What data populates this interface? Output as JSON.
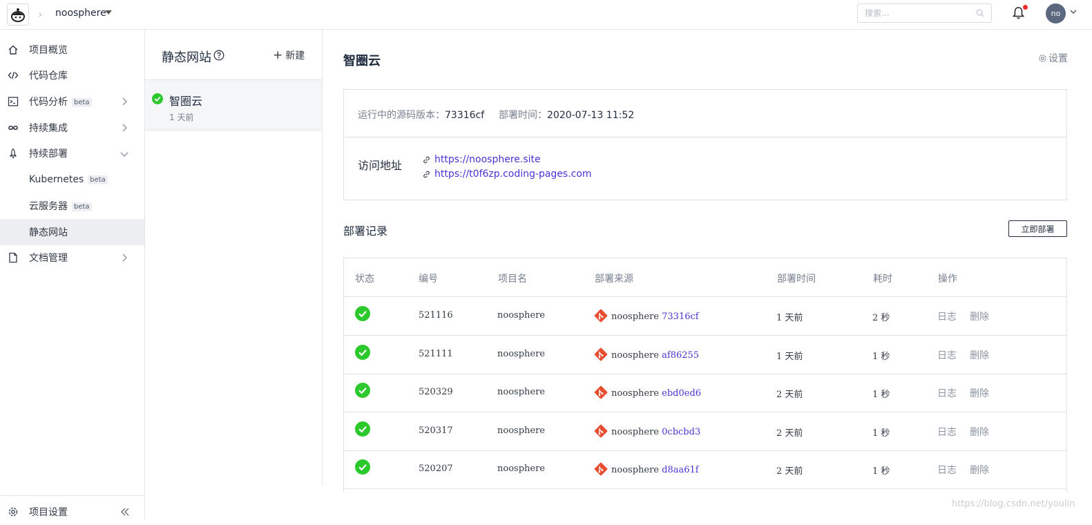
{
  "header": {
    "project_name": "noosphere",
    "search_placeholder": "搜索...",
    "avatar_initials": "no",
    "colors": {
      "notification_dot": "#f02d2d",
      "avatar_bg": "#5c6780"
    }
  },
  "sidebar": {
    "items": [
      {
        "label": "项目概览",
        "icon": "home-icon"
      },
      {
        "label": "代码仓库",
        "icon": "code-icon"
      },
      {
        "label": "代码分析",
        "icon": "terminal-icon",
        "badge": "beta"
      },
      {
        "label": "持续集成",
        "icon": "infinity-icon"
      },
      {
        "label": "持续部署",
        "icon": "rocket-icon"
      },
      {
        "label": "Kubernetes",
        "badge": "beta"
      },
      {
        "label": "云服务器",
        "badge": "beta"
      },
      {
        "label": "静态网站"
      },
      {
        "label": "文档管理",
        "icon": "document-icon"
      }
    ],
    "bottom": {
      "label": "项目设置"
    }
  },
  "sites_panel": {
    "title": "静态网站",
    "new_label": "新建",
    "sites": [
      {
        "name": "智圈云",
        "time": "1 天前"
      }
    ]
  },
  "main": {
    "title": "智圈云",
    "settings_label": "设置",
    "source_label": "运行中的源码版本：",
    "source_value": "73316cf",
    "deploy_time_label": "部署时间：",
    "deploy_time_value": "2020-07-13 11:52",
    "visit_label": "访问地址",
    "links": [
      "https://noosphere.site",
      "https://t0f6zp.coding-pages.com"
    ],
    "records_title": "部署记录",
    "deploy_now": "立即部署",
    "table": {
      "headers": [
        "状态",
        "编号",
        "项目名",
        "部署来源",
        "部署时间",
        "耗时",
        "操作"
      ],
      "rows": [
        {
          "id": "521116",
          "project": "noosphere",
          "source": "noosphere",
          "commit": "73316cf",
          "time": "1 天前",
          "duration": "2 秒",
          "log": "日志",
          "delete": "删除"
        },
        {
          "id": "521111",
          "project": "noosphere",
          "source": "noosphere",
          "commit": "af86255",
          "time": "1 天前",
          "duration": "1 秒",
          "log": "日志",
          "delete": "删除"
        },
        {
          "id": "520329",
          "project": "noosphere",
          "source": "noosphere",
          "commit": "ebd0ed6",
          "time": "2 天前",
          "duration": "1 秒",
          "log": "日志",
          "delete": "删除"
        },
        {
          "id": "520317",
          "project": "noosphere",
          "source": "noosphere",
          "commit": "0cbcbd3",
          "time": "2 天前",
          "duration": "1 秒",
          "log": "日志",
          "delete": "删除"
        },
        {
          "id": "520207",
          "project": "noosphere",
          "source": "noosphere",
          "commit": "d8aa61f",
          "time": "2 天前",
          "duration": "1 秒",
          "log": "日志",
          "delete": "删除"
        }
      ]
    }
  },
  "watermark": "https://blog.csdn.net/youlin"
}
